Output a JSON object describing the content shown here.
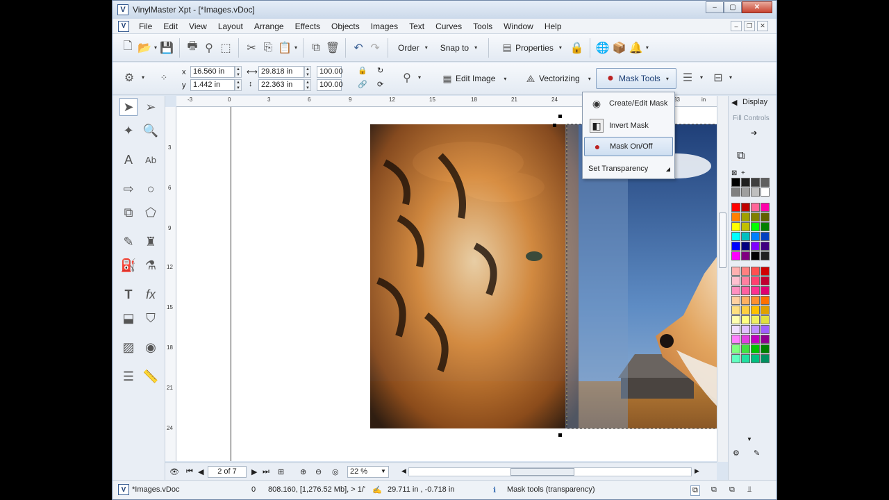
{
  "window": {
    "title": "VinylMaster Xpt - [*Images.vDoc]",
    "app_letter": "V"
  },
  "menubar": {
    "items": [
      "File",
      "Edit",
      "View",
      "Layout",
      "Arrange",
      "Effects",
      "Objects",
      "Images",
      "Text",
      "Curves",
      "Tools",
      "Window",
      "Help"
    ]
  },
  "toolbar1": {
    "order_label": "Order",
    "snap_label": "Snap to",
    "properties_label": "Properties"
  },
  "toolbar2": {
    "x_label": "x",
    "y_label": "y",
    "x_value": "16.560 in",
    "y_value": "1.442 in",
    "width_value": "29.818 in",
    "height_value": "22.363 in",
    "scale_w": "100.00",
    "scale_h": "100.00",
    "edit_image_label": "Edit Image",
    "vectorizing_label": "Vectorizing",
    "mask_tools_label": "Mask Tools"
  },
  "ruler": {
    "h_ticks": [
      "-3",
      "0",
      "3",
      "6",
      "9",
      "12",
      "15",
      "18",
      "21",
      "24",
      "33",
      "in"
    ],
    "v_ticks": [
      "3",
      "6",
      "9",
      "12",
      "15",
      "18",
      "21",
      "24"
    ]
  },
  "mask_menu": {
    "items": [
      "Create/Edit Mask",
      "Invert Mask",
      "Mask On/Off",
      "Set Transparency"
    ],
    "highlighted": "Mask On/Off"
  },
  "right_panel": {
    "display_label": "Display",
    "fill_controls_label": "Fill Controls"
  },
  "palette": {
    "grays": [
      "#000000",
      "#1f1f1f",
      "#3f3f3f",
      "#5f5f5f",
      "#7f7f7f",
      "#9f9f9f",
      "#bfbfbf",
      "#ffffff"
    ],
    "colors": [
      "#ff0000",
      "#c00000",
      "#ff6699",
      "#ff00aa",
      "#ff8000",
      "#a0a000",
      "#808000",
      "#606000",
      "#ffff00",
      "#c0c000",
      "#00ff00",
      "#008000",
      "#00ffff",
      "#00c0c0",
      "#0080ff",
      "#0040c0",
      "#0000ff",
      "#000080",
      "#8000ff",
      "#400080",
      "#ff00ff",
      "#800080",
      "#000000",
      "#202020"
    ],
    "pastels": [
      "#ffb0b0",
      "#ff8080",
      "#ff5050",
      "#d00000",
      "#ffc0d0",
      "#ff80a0",
      "#ff4070",
      "#c00030",
      "#ff90c0",
      "#ff60a0",
      "#ff3090",
      "#e00070",
      "#ffd0a0",
      "#ffb060",
      "#ff9030",
      "#ff7000",
      "#ffe080",
      "#ffd040",
      "#ffc000",
      "#e0a000",
      "#ffffb0",
      "#ffff80",
      "#f0f060",
      "#e0e040",
      "#f0e0ff",
      "#e0c0ff",
      "#c090ff",
      "#a060ff",
      "#ff80ff",
      "#e040e0",
      "#c000c0",
      "#900090",
      "#80ff80",
      "#40e040",
      "#00c000",
      "#008000",
      "#60ffc0",
      "#20e0a0",
      "#00c080",
      "#009060"
    ]
  },
  "navigation": {
    "page_label": "2 of 7",
    "zoom_value": "22 %"
  },
  "status": {
    "doc_name": "*Images.vDoc",
    "count": "0",
    "memory": "808.160, [1,276.52 Mb], > 1/'",
    "coords": "29.711 in , -0.718 in",
    "hint": "Mask tools (transparency)"
  }
}
